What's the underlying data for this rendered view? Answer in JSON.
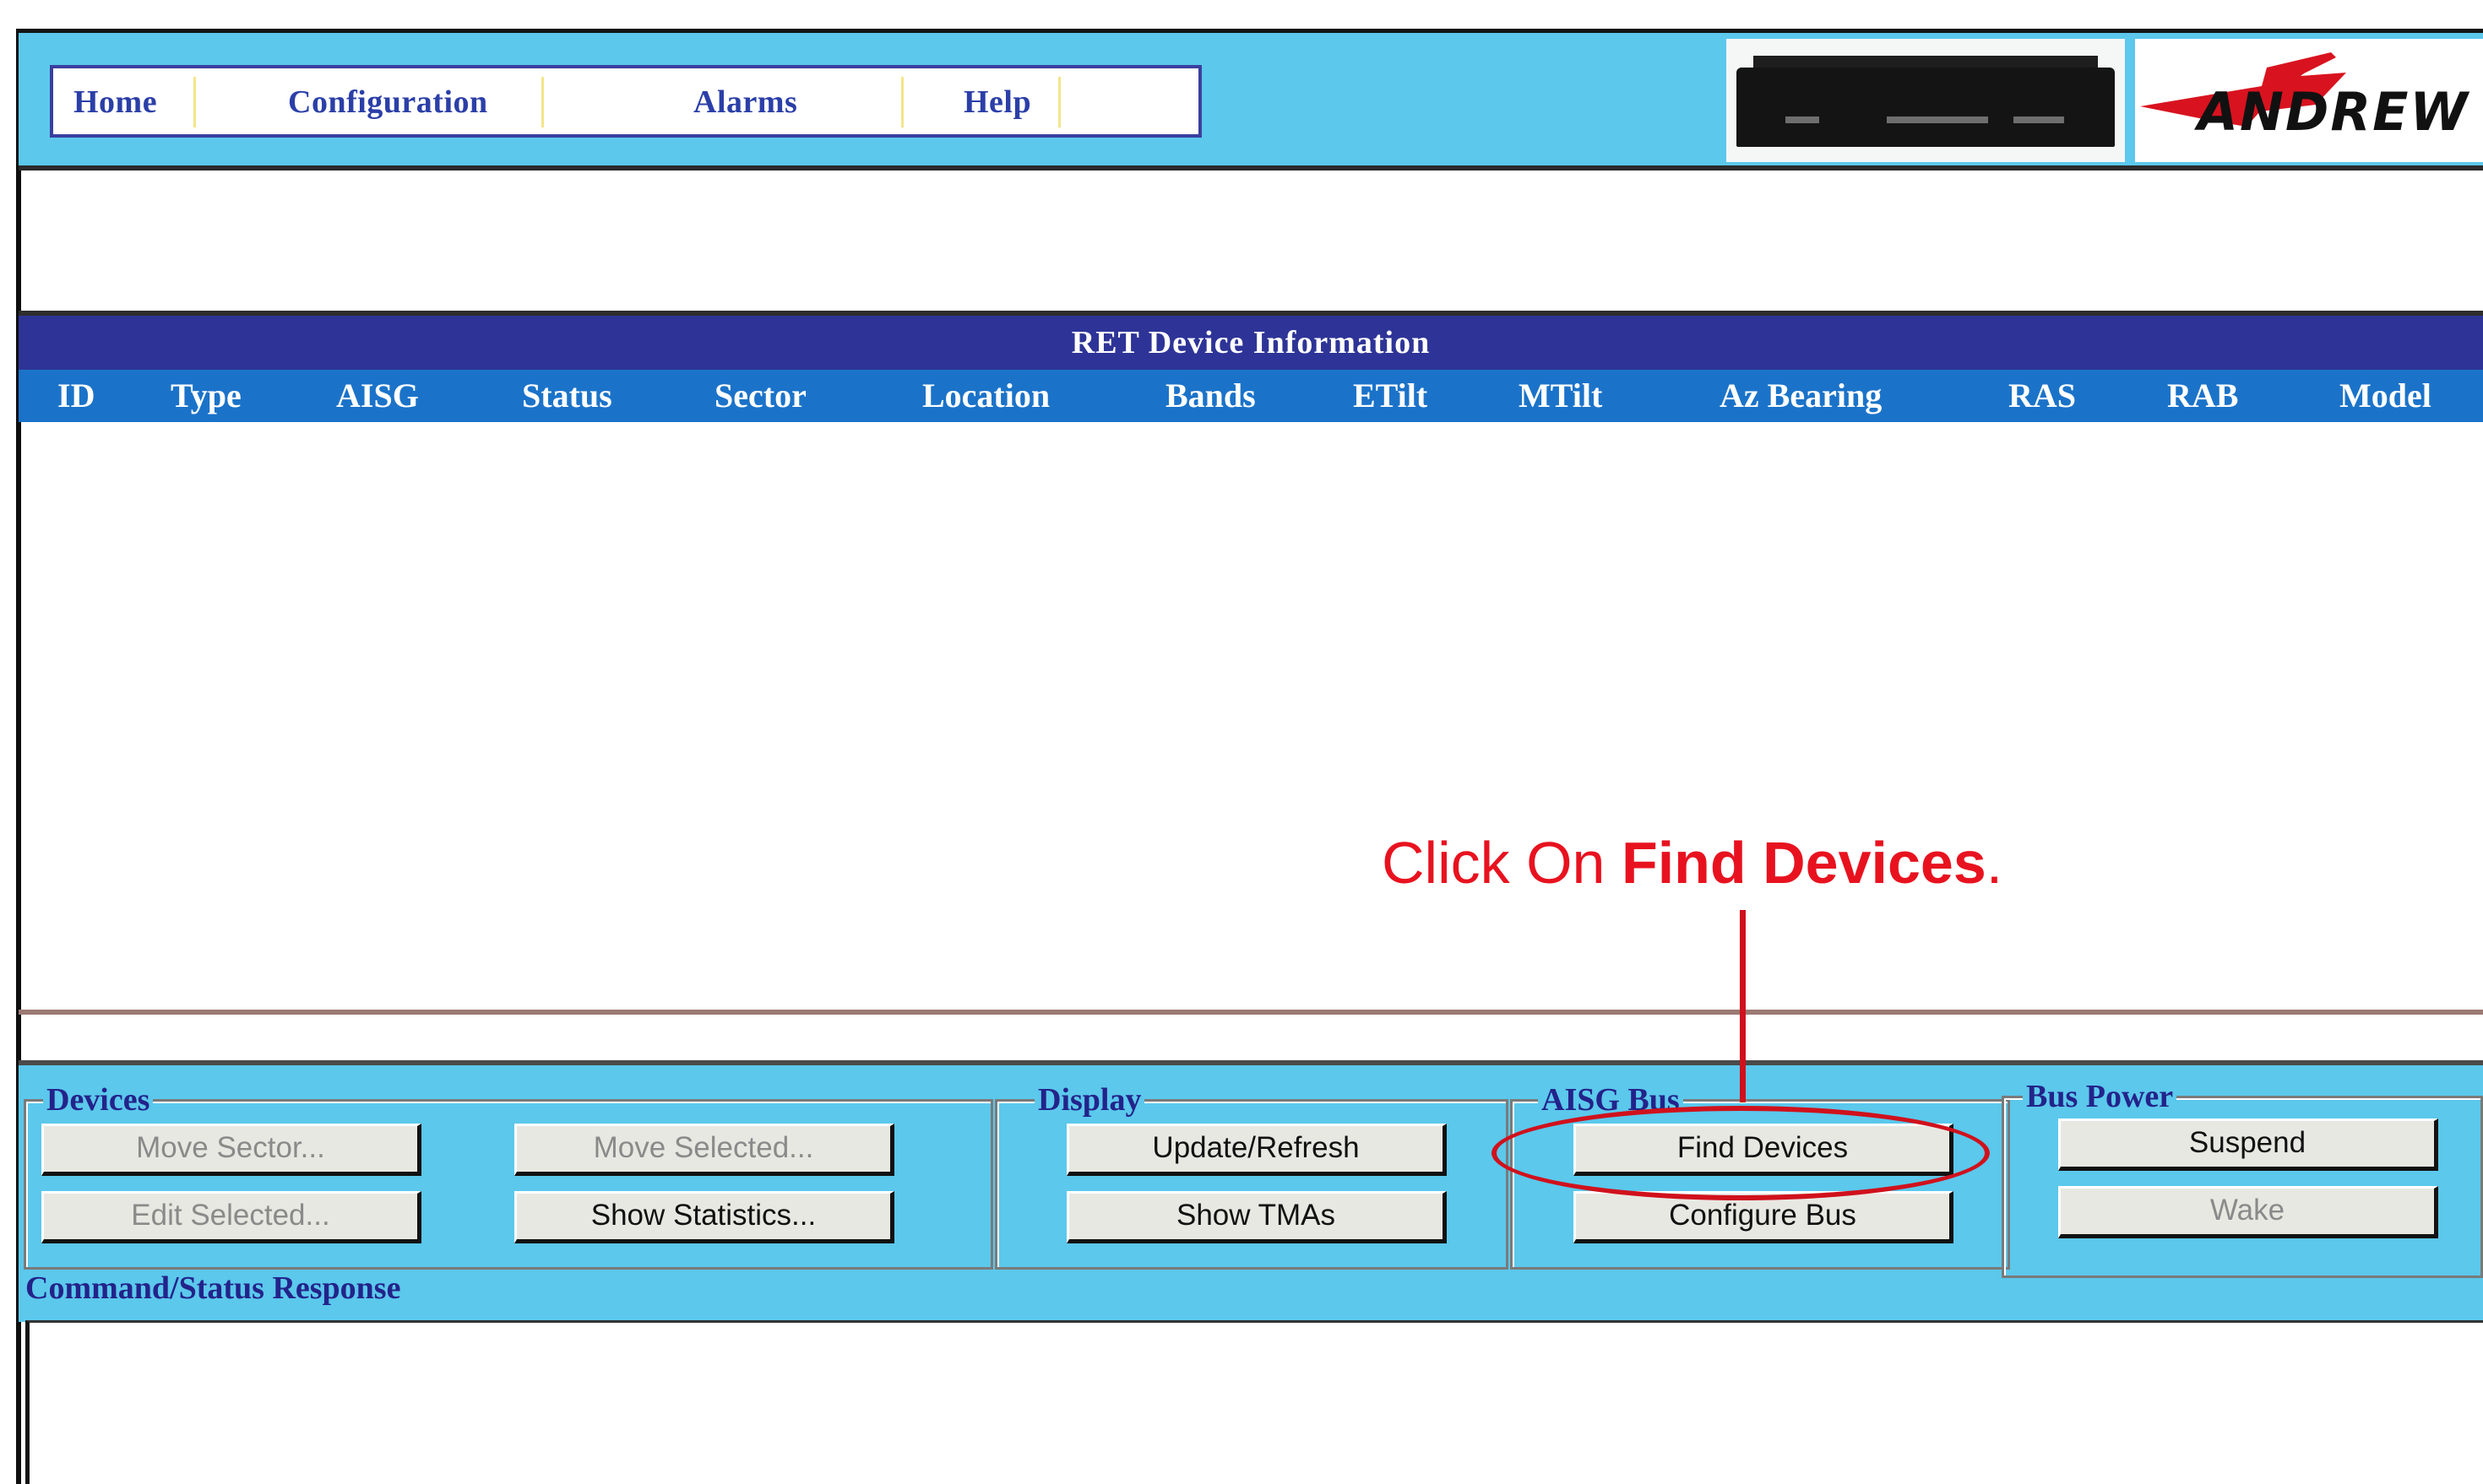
{
  "nav": {
    "home": "Home",
    "configuration": "Configuration",
    "alarms": "Alarms",
    "help": "Help"
  },
  "logo": {
    "text": "ANDREW",
    "color": "#d8131f"
  },
  "table": {
    "title": "RET Device Information",
    "columns": [
      "ID",
      "Type",
      "AISG",
      "Status",
      "Sector",
      "Location",
      "Bands",
      "ETilt",
      "MTilt",
      "Az Bearing",
      "RAS",
      "RAB",
      "Model"
    ],
    "rows": []
  },
  "groups": {
    "devices": {
      "label": "Devices",
      "move_sector": "Move Sector...",
      "move_selected": "Move Selected...",
      "edit_selected": "Edit Selected...",
      "show_statistics": "Show Statistics..."
    },
    "display": {
      "label": "Display",
      "update_refresh": "Update/Refresh",
      "show_tmas": "Show TMAs"
    },
    "aisg_bus": {
      "label": "AISG Bus",
      "find_devices": "Find Devices",
      "configure_bus": "Configure Bus"
    },
    "bus_power": {
      "label": "Bus Power",
      "suspend": "Suspend",
      "wake": "Wake"
    }
  },
  "status": {
    "label": "Command/Status Response",
    "text": ""
  },
  "annotation": {
    "prefix": "Click On ",
    "emphasis": "Find Devices",
    "suffix": ".",
    "color": "#e8121f"
  },
  "colors": {
    "panel": "#5bc8ec",
    "table_title": "#2e3497",
    "table_header": "#1b73c9"
  }
}
